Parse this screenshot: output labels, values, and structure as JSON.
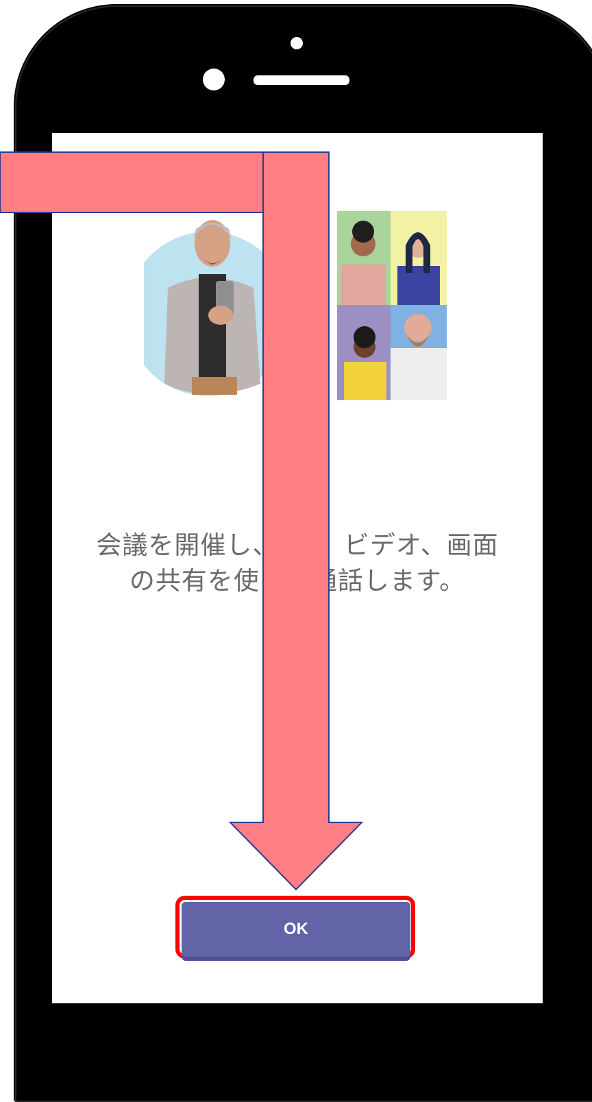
{
  "screen": {
    "caption_line1": "会議を開催し、　　、ビデオ、画面",
    "caption_line2": "の共有を使っ　通話します。"
  },
  "actions": {
    "ok_label": "OK"
  },
  "colors": {
    "button": "#6264a7",
    "highlight_outline": "#ff0000",
    "arrow_fill": "#ff7f84",
    "arrow_stroke": "#2f3a8f"
  },
  "icons": [
    "front-camera-icon",
    "earpiece-speaker-icon",
    "person-with-phone-illustration",
    "video-call-grid-illustration"
  ]
}
